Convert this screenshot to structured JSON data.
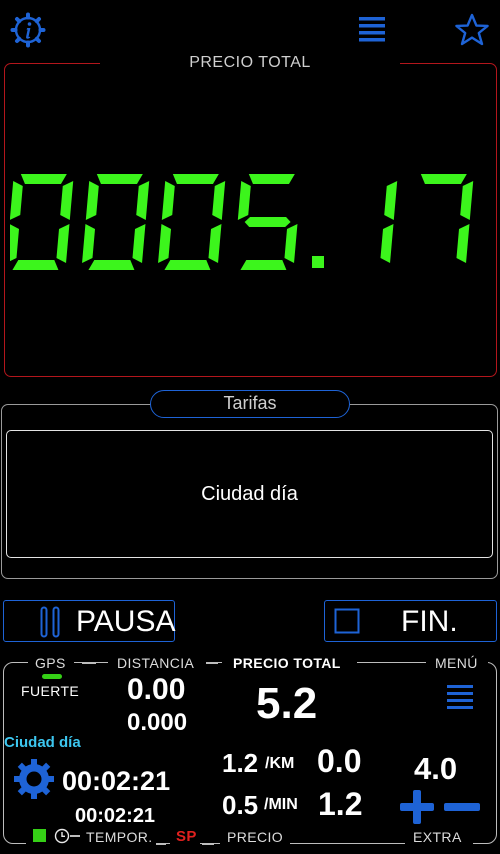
{
  "header": {
    "info_icon": "info-gear-icon",
    "menu_icon": "hamburger-menu-icon",
    "favorite_icon": "star-outline-icon"
  },
  "price_panel": {
    "title": "PRECIO TOTAL",
    "display": "0005.17"
  },
  "tarifas": {
    "title": "Tarifas",
    "selected": "Ciudad día"
  },
  "buttons": {
    "pause_label": "PAUSA",
    "end_label": "FIN."
  },
  "bottom": {
    "gps_label": "GPS",
    "gps_signal": "FUERTE",
    "distance_label": "DISTANCIA",
    "distance_value": "0.00",
    "distance_value_2": "0.000",
    "total_label": "PRECIO TOTAL",
    "total_value": "5.2",
    "menu_label": "MENÚ",
    "tariff_name": "Ciudad día",
    "timer_1": "00:02:21",
    "timer_2": "00:02:21",
    "rate_km": "1.2",
    "rate_km_unit": "/KM",
    "rate_min": "0.5",
    "rate_min_unit": "/MIN",
    "price_km": "0.0",
    "price_min": "1.2",
    "extra_value": "4.0",
    "temp_label": "TEMPOR.",
    "sp_label": "SP",
    "price_label": "PRECIO",
    "extra_label": "EXTRA"
  },
  "colors": {
    "accent_blue": "#1e63d6",
    "digits_green": "#3cf51c",
    "panel_red": "#b3161c",
    "gps_green": "#35d016",
    "tariff_cyan": "#3cc6ef",
    "sp_red": "#e0201e"
  }
}
